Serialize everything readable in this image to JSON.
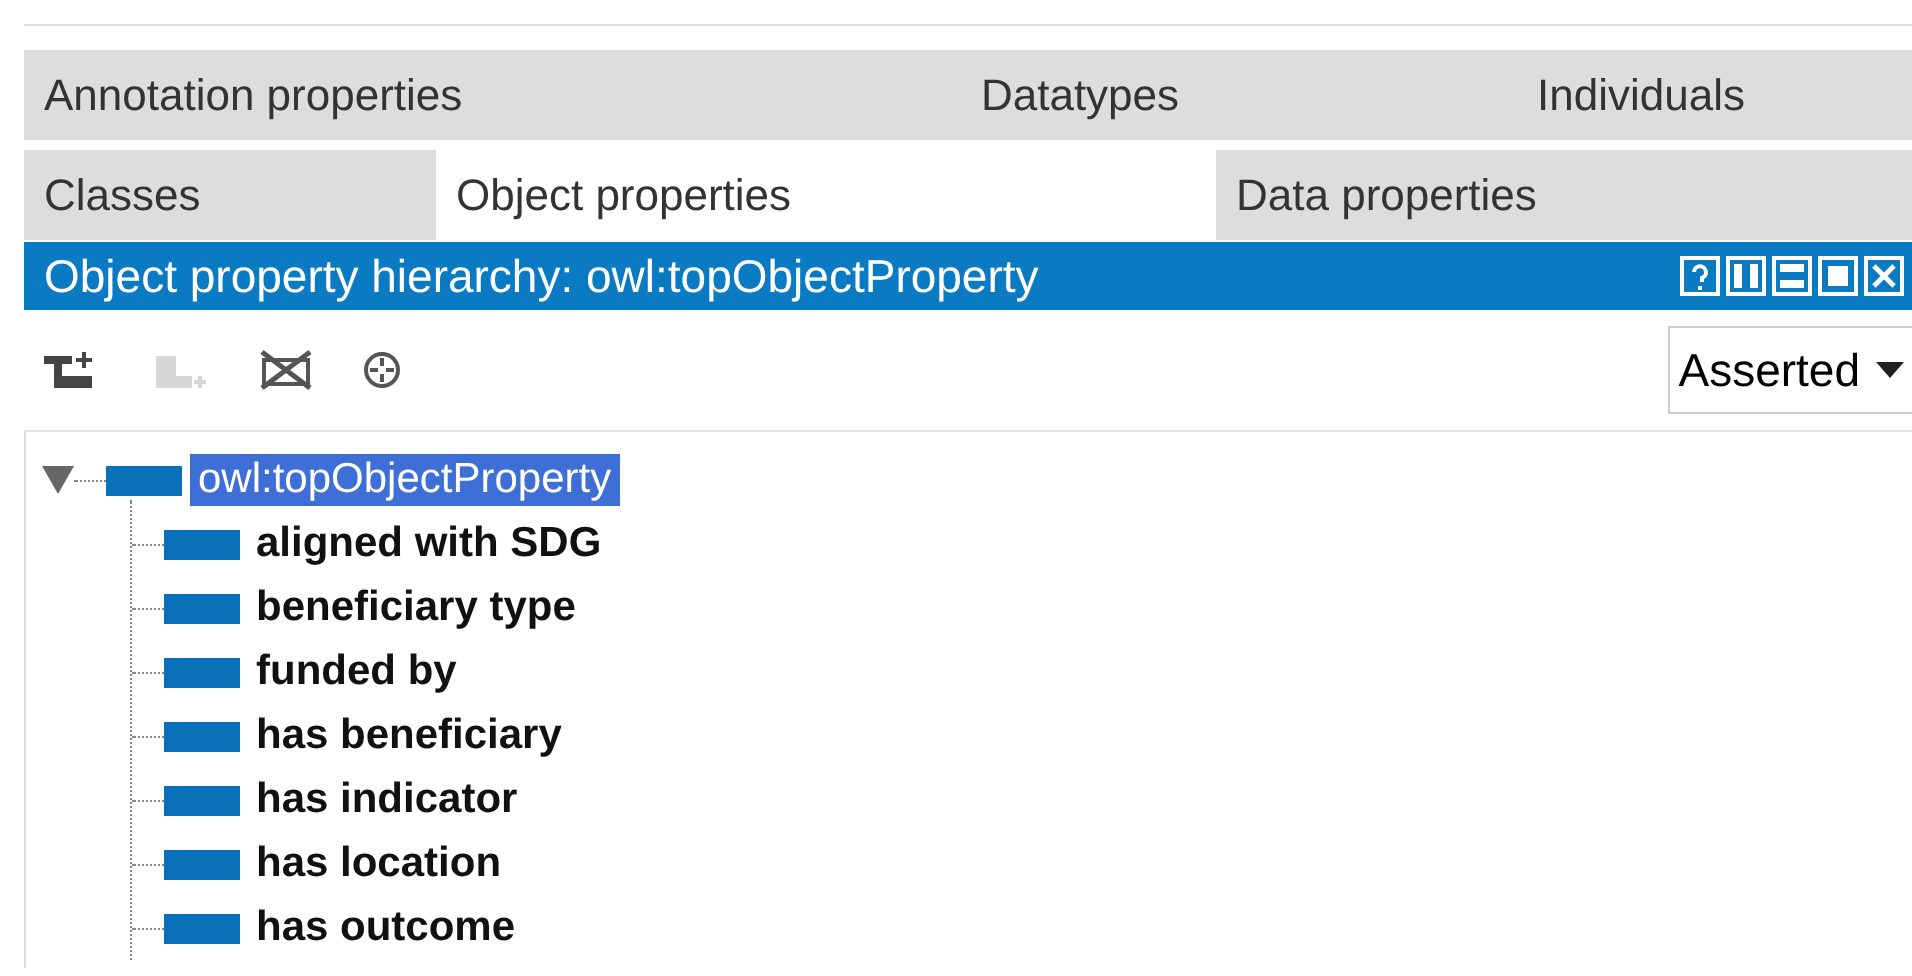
{
  "tab_rows": [
    [
      {
        "label": "Annotation properties",
        "selected": false
      },
      {
        "label": "Datatypes",
        "selected": false
      },
      {
        "label": "Individuals",
        "selected": false
      }
    ],
    [
      {
        "label": "Classes",
        "selected": false
      },
      {
        "label": "Object properties",
        "selected": true
      },
      {
        "label": "Data properties",
        "selected": false
      }
    ]
  ],
  "view": {
    "title": "Object property hierarchy: owl:topObjectProperty"
  },
  "toolbar": {
    "buttons": [
      {
        "kind": "add-sub",
        "disabled": false
      },
      {
        "kind": "add-sibling",
        "disabled": true
      },
      {
        "kind": "delete",
        "disabled": false
      },
      {
        "kind": "target",
        "disabled": false
      }
    ],
    "mode": {
      "value": "Asserted"
    }
  },
  "tree": [
    {
      "label": "owl:topObjectProperty",
      "selected": true,
      "expanded": true,
      "children": [
        {
          "label": "aligned with SDG",
          "selected": false
        },
        {
          "label": "beneficiary type",
          "selected": false
        },
        {
          "label": "funded by",
          "selected": false
        },
        {
          "label": "has beneficiary",
          "selected": false
        },
        {
          "label": "has indicator",
          "selected": false
        },
        {
          "label": "has location",
          "selected": false
        },
        {
          "label": "has outcome",
          "selected": false
        }
      ]
    }
  ]
}
